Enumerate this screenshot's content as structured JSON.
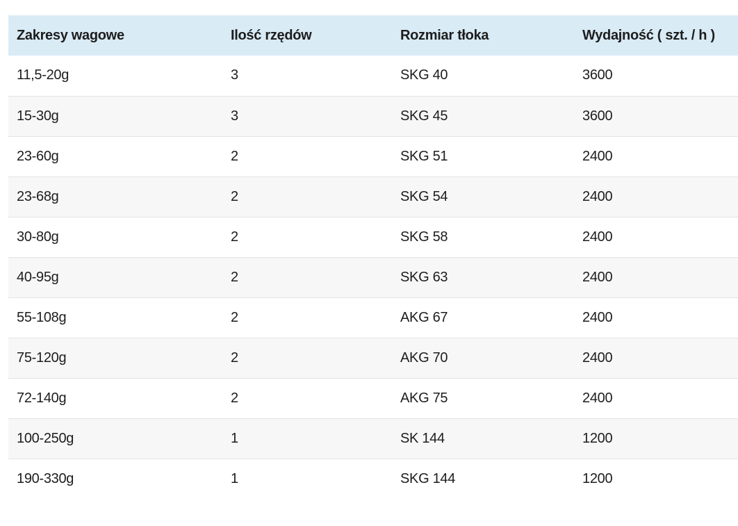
{
  "table": {
    "headers": [
      "Zakresy wagowe",
      "Ilość rzędów",
      "Rozmiar tłoka",
      "Wydajność ( szt. / h )"
    ],
    "rows": [
      [
        "11,5-20g",
        "3",
        "SKG 40",
        "3600"
      ],
      [
        "15-30g",
        "3",
        "SKG 45",
        "3600"
      ],
      [
        "23-60g",
        "2",
        "SKG 51",
        "2400"
      ],
      [
        "23-68g",
        "2",
        "SKG 54",
        "2400"
      ],
      [
        "30-80g",
        "2",
        "SKG 58",
        "2400"
      ],
      [
        "40-95g",
        "2",
        "SKG 63",
        "2400"
      ],
      [
        "55-108g",
        "2",
        "AKG 67",
        "2400"
      ],
      [
        "75-120g",
        "2",
        "AKG 70",
        "2400"
      ],
      [
        "72-140g",
        "2",
        "AKG 75",
        "2400"
      ],
      [
        "100-250g",
        "1",
        "SK 144",
        "1200"
      ],
      [
        "190-330g",
        "1",
        "SKG 144",
        "1200"
      ]
    ]
  },
  "colors": {
    "header_bg": "#d9ebf5",
    "row_alt_bg": "#f7f7f7",
    "row_border": "#e3e3e3",
    "text": "#1d1d1d"
  }
}
